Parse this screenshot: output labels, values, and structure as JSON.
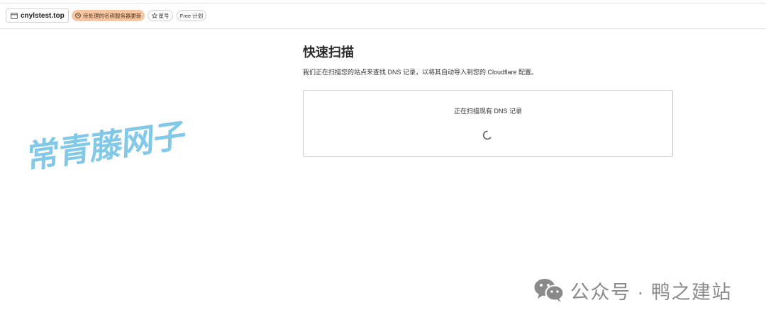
{
  "header": {
    "site_name": "cnylstest.top",
    "site_icon": "window-icon",
    "status_badge": "待处理的名称服务器更新",
    "status_icon": "clock-icon",
    "star_label": "星号",
    "star_icon": "star-icon",
    "plan_label": "Free 计划"
  },
  "main": {
    "title": "快速扫描",
    "description": "我们正在扫描您的站点来查找 DNS 记录，以将其自动导入到您的 Cloudflare 配置。",
    "scan_card": {
      "status_text": "正在扫描现有 DNS 记录",
      "spinner_icon": "spinner-icon"
    }
  },
  "watermarks": {
    "overlay_text": "常青藤网子",
    "footer_account": "公众号 · 鸭之建站",
    "footer_icon": "wechat-icon"
  },
  "colors": {
    "status_badge_bg": "#f8c7a1",
    "overlay_watermark": "#7cc6e8",
    "footer_watermark": "#8a8a8a",
    "border": "#d0d0d0"
  }
}
